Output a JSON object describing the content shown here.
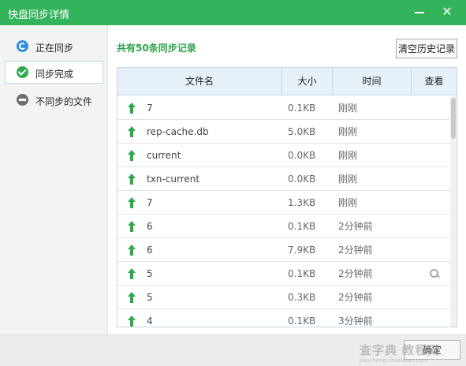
{
  "window": {
    "title": "快盘同步详情",
    "minimize_label": "",
    "close_label": "✕"
  },
  "sidebar": {
    "items": [
      {
        "label": "正在同步",
        "icon": "sync-icon",
        "active": false
      },
      {
        "label": "同步完成",
        "icon": "check-circle-icon",
        "active": true
      },
      {
        "label": "不同步的文件",
        "icon": "minus-circle-icon",
        "active": false
      }
    ]
  },
  "main": {
    "record_count": "共有50条同步记录",
    "clear_history_label": "清空历史记录",
    "columns": [
      "文件名",
      "大小",
      "时间",
      "查看"
    ],
    "rows": [
      {
        "name": "7",
        "size": "0.1KB",
        "time": "刚刚",
        "view": ""
      },
      {
        "name": "rep-cache.db",
        "size": "5.0KB",
        "time": "刚刚",
        "view": ""
      },
      {
        "name": "current",
        "size": "0.0KB",
        "time": "刚刚",
        "view": ""
      },
      {
        "name": "txn-current",
        "size": "0.0KB",
        "time": "刚刚",
        "view": ""
      },
      {
        "name": "7",
        "size": "1.3KB",
        "time": "刚刚",
        "view": ""
      },
      {
        "name": "6",
        "size": "0.1KB",
        "time": "2分钟前",
        "view": ""
      },
      {
        "name": "6",
        "size": "7.9KB",
        "time": "2分钟前",
        "view": ""
      },
      {
        "name": "5",
        "size": "0.1KB",
        "time": "2分钟前",
        "view": "magnifier-icon"
      },
      {
        "name": "5",
        "size": "0.3KB",
        "time": "2分钟前",
        "view": ""
      },
      {
        "name": "4",
        "size": "0.1KB",
        "time": "3分钟前",
        "view": ""
      }
    ]
  },
  "footer": {
    "ok_label": "确定",
    "watermark": "查字典 教程网",
    "watermark_sub": "jiaocheng.chazidian.com"
  },
  "colors": {
    "accent": "#33b35a",
    "count_text": "#2ea34a",
    "header_bg": "#e6f0f8",
    "up_arrow": "#2fa84f"
  }
}
